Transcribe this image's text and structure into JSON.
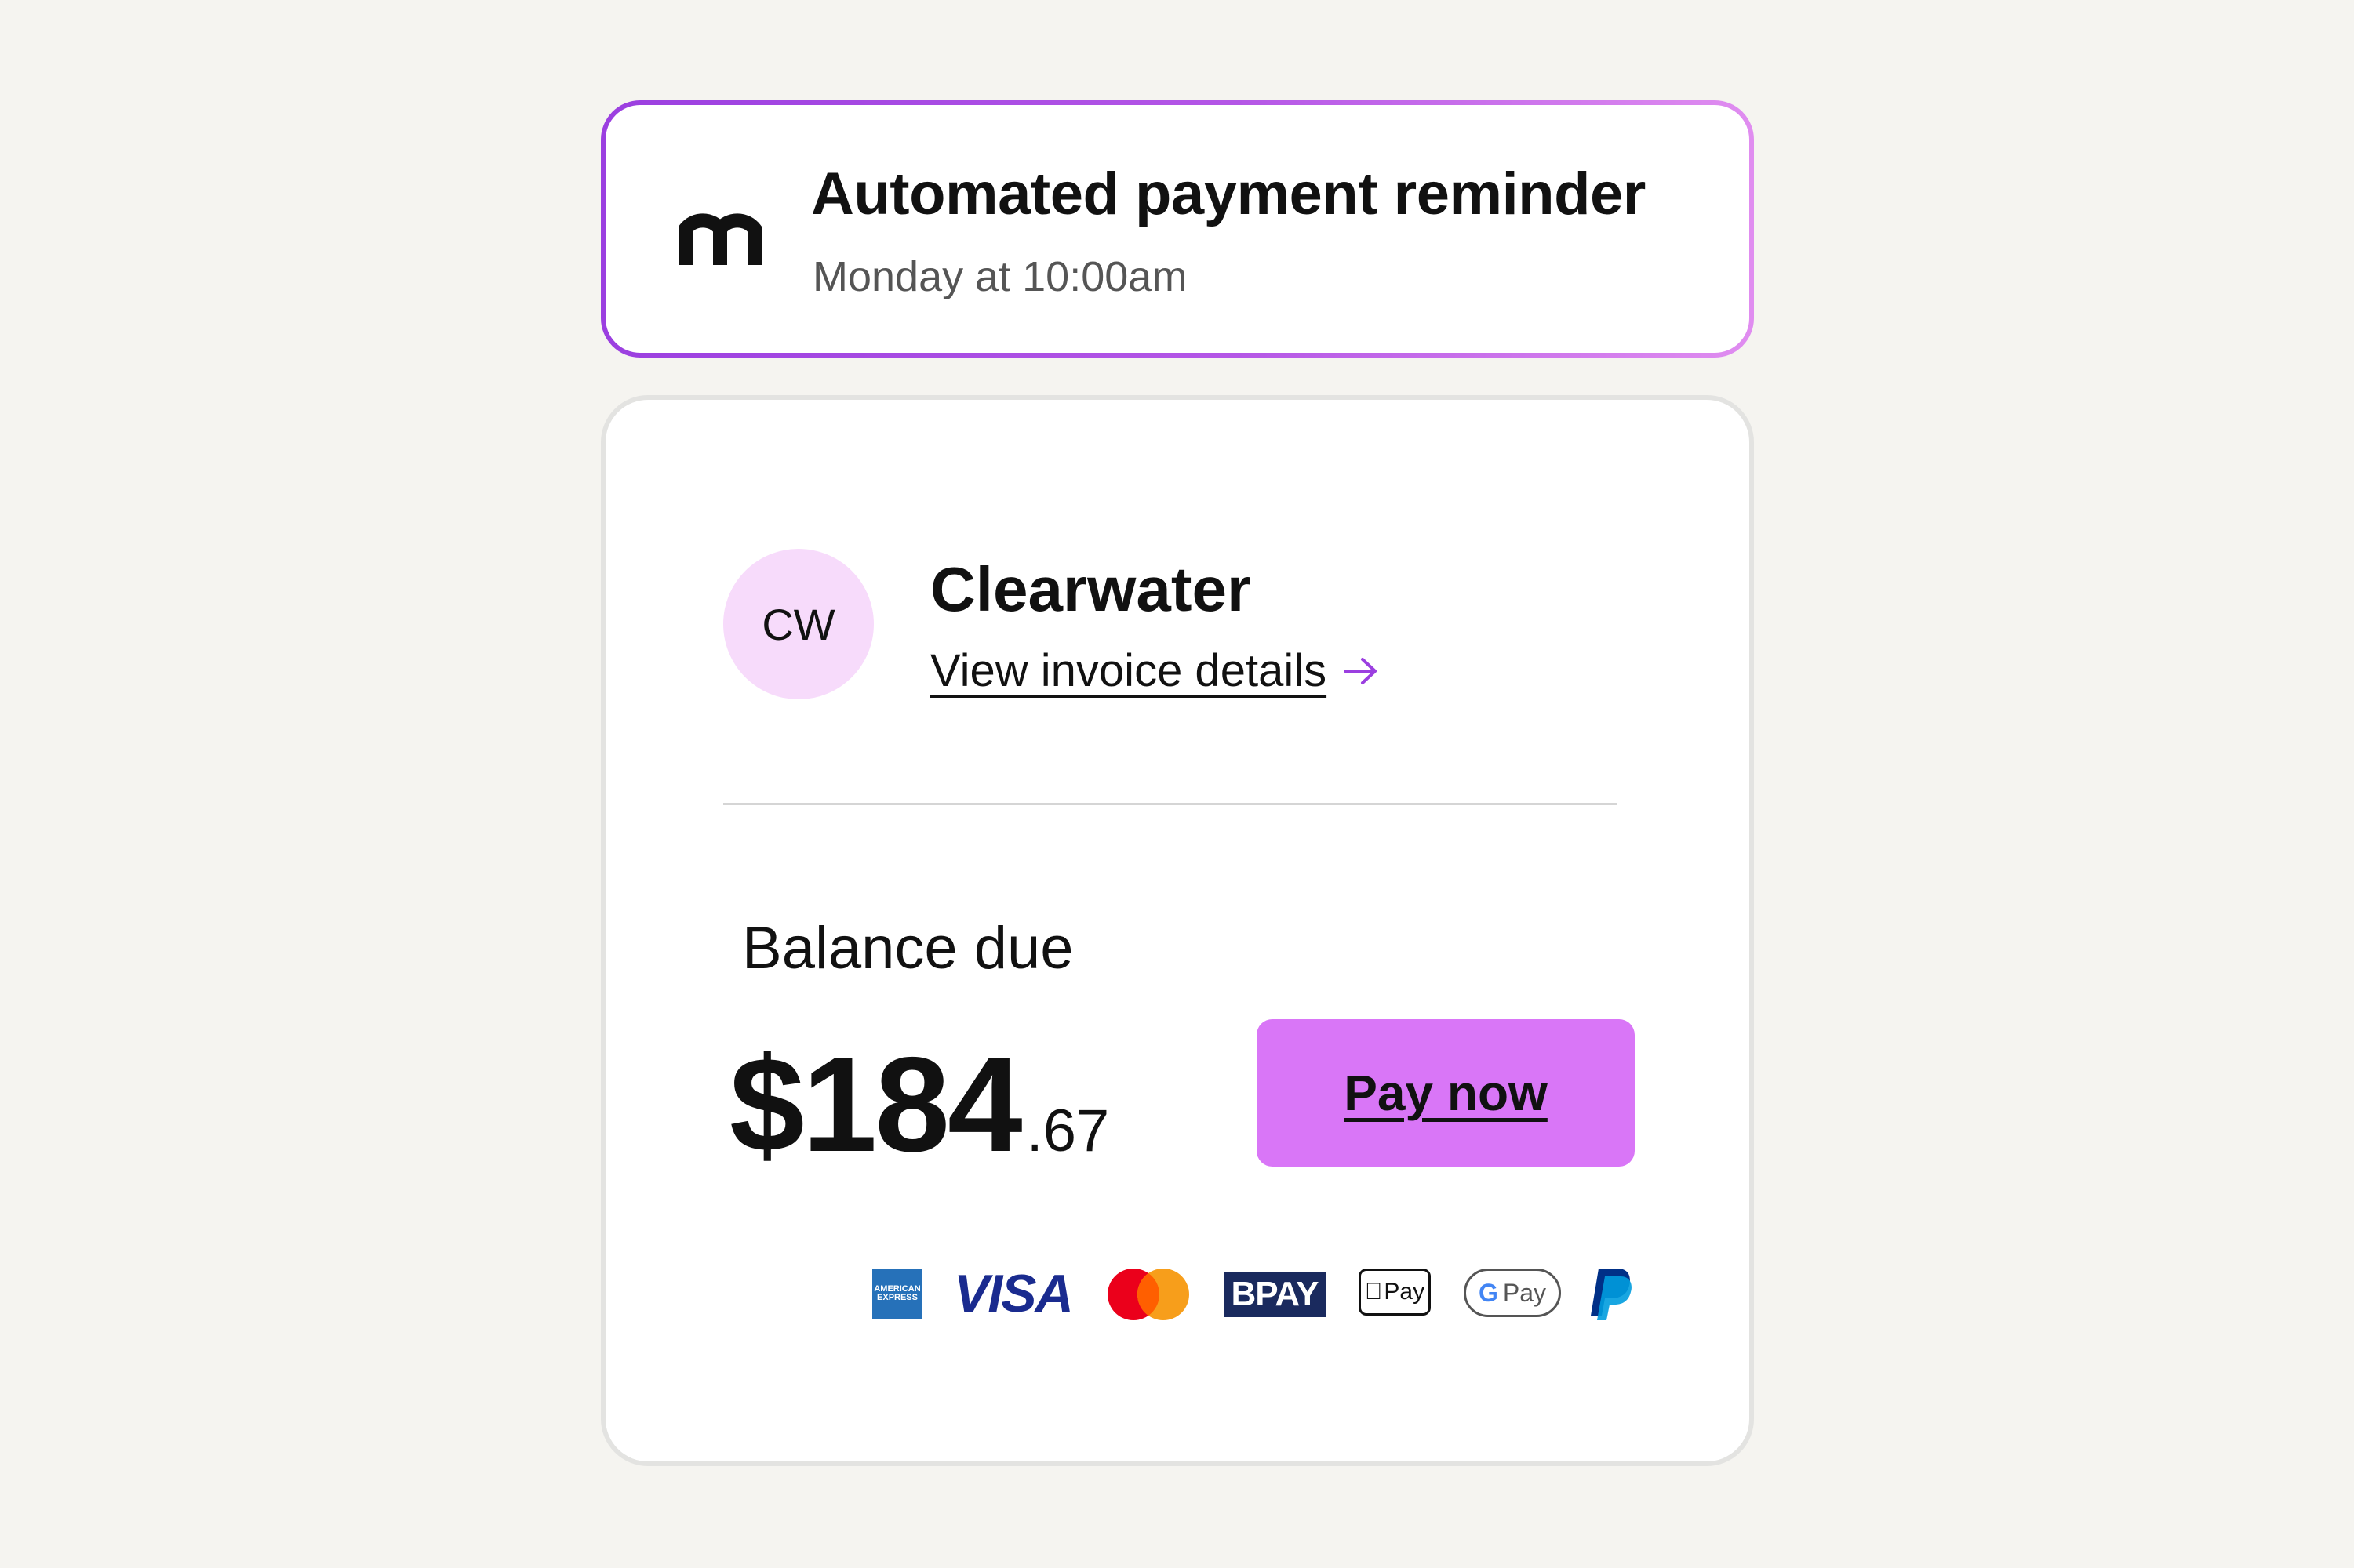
{
  "notification": {
    "title": "Automated payment reminder",
    "subtitle": "Monday at 10:00am",
    "logo_icon": "m-logo-icon"
  },
  "invoice": {
    "avatar_initials": "CW",
    "company": "Clearwater",
    "details_link": "View invoice details",
    "balance_label": "Balance due",
    "amount_main": "$184",
    "amount_cents": ".67",
    "pay_button": "Pay now"
  },
  "payment_methods": {
    "amex": "AMERICAN EXPRESS",
    "visa": "VISA",
    "mastercard": "mastercard-icon",
    "bpay": "BPAY",
    "apple_pay": "Pay",
    "google_pay": "Pay",
    "paypal": "paypal-icon"
  },
  "colors": {
    "accent": "#d976f7",
    "avatar_bg": "#f7dbfb",
    "border_gradient_start": "#9b3fe0",
    "border_gradient_end": "#e08df0",
    "link_arrow": "#9b3fe0"
  }
}
